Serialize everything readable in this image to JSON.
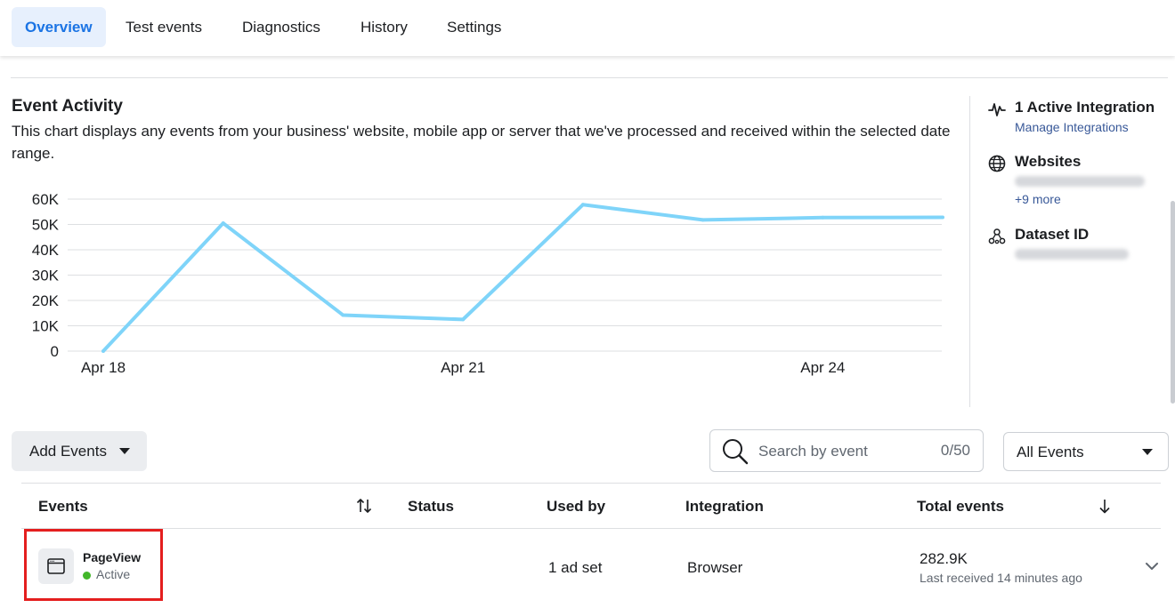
{
  "tabs": [
    {
      "label": "Overview",
      "active": true
    },
    {
      "label": "Test events"
    },
    {
      "label": "Diagnostics"
    },
    {
      "label": "History"
    },
    {
      "label": "Settings"
    }
  ],
  "activity": {
    "title": "Event Activity",
    "description": "This chart displays any events from your business' website, mobile app or server that we've processed and received within the selected date range."
  },
  "chart_data": {
    "type": "line",
    "x": [
      "Apr 18",
      "Apr 19",
      "Apr 20",
      "Apr 21",
      "Apr 22",
      "Apr 23",
      "Apr 24",
      "Apr 25"
    ],
    "values": [
      0,
      50500,
      14200,
      12500,
      57800,
      51800,
      52700,
      52800
    ],
    "x_tick_labels": [
      "Apr 18",
      "Apr 21",
      "Apr 24"
    ],
    "y_ticks": [
      "0",
      "10K",
      "20K",
      "30K",
      "40K",
      "50K",
      "60K"
    ],
    "ylim": [
      0,
      60000
    ],
    "grid": true,
    "color": "#7fd4f9"
  },
  "sidebar": {
    "integration_title": "1 Active Integration",
    "integration_link": "Manage Integrations",
    "websites_title": "Websites",
    "websites_more": "+9 more",
    "dataset_title": "Dataset ID"
  },
  "toolbar": {
    "add_events": "Add Events",
    "search_placeholder": "Search by event",
    "search_count": "0/50",
    "filter_value": "All Events"
  },
  "table": {
    "headers": {
      "events": "Events",
      "status": "Status",
      "used_by": "Used by",
      "integration": "Integration",
      "total": "Total events"
    },
    "rows": [
      {
        "name": "PageView",
        "status": "Active",
        "used_by": "1 ad set",
        "integration": "Browser",
        "total": "282.9K",
        "last_received": "Last received 14 minutes ago"
      }
    ]
  },
  "colors": {
    "accent": "#1b74e4",
    "active_tab_bg": "#e7f0fd",
    "status_active": "#42b72a",
    "highlight": "#e41e1e",
    "line": "#7fd4f9"
  }
}
